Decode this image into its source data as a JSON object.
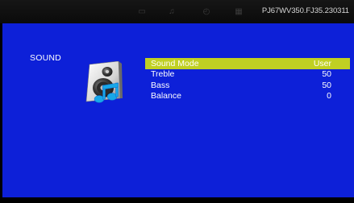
{
  "topbar": {
    "icons": [
      {
        "name": "tv-icon",
        "glyph": "▭"
      },
      {
        "name": "music-icon",
        "glyph": "♫"
      },
      {
        "name": "clock-icon",
        "glyph": "◴"
      },
      {
        "name": "grid-icon",
        "glyph": "▦"
      }
    ],
    "version": "PJ67WV350.FJ35.230311"
  },
  "section": {
    "label": "SOUND",
    "icon": "speaker-music-icon"
  },
  "menu": {
    "items": [
      {
        "label": "Sound Mode",
        "value": "User",
        "selected": true
      },
      {
        "label": "Treble",
        "value": "50",
        "selected": false
      },
      {
        "label": "Bass",
        "value": "50",
        "selected": false
      },
      {
        "label": "Balance",
        "value": "0",
        "selected": false
      }
    ]
  },
  "colors": {
    "panel": "#0d20d8",
    "highlight": "#c0d023",
    "text": "#ffffff",
    "topbar": "#0f0f0f"
  }
}
